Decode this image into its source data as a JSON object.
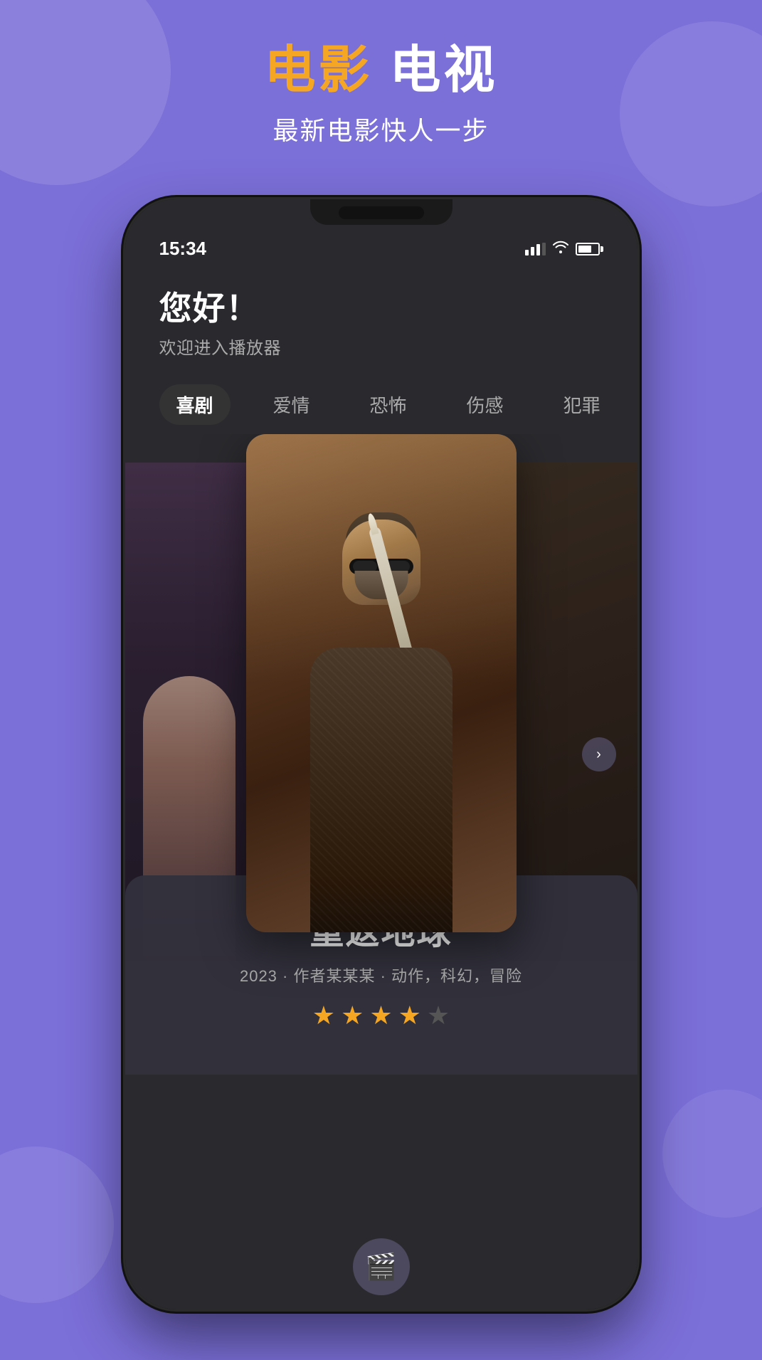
{
  "background": {
    "color": "#7B6FD8"
  },
  "header": {
    "title_movie": "电影",
    "title_tv": "电视",
    "subtitle": "最新电影快人一步"
  },
  "phone": {
    "status_bar": {
      "time": "15:34"
    },
    "greeting": {
      "title": "您好！",
      "subtitle": "欢迎进入播放器"
    },
    "genres": {
      "items": [
        {
          "label": "喜剧",
          "active": true
        },
        {
          "label": "爱情",
          "active": false
        },
        {
          "label": "恐怖",
          "active": false
        },
        {
          "label": "伤感",
          "active": false
        },
        {
          "label": "犯罪",
          "active": false
        }
      ]
    },
    "movie": {
      "title": "重返地球",
      "year": "2023",
      "author": "作者某某某",
      "genres": "动作，科幻，冒险",
      "meta_line": "2023  ·  作者某某某  ·  动作，科幻，冒险",
      "rating": 4,
      "max_rating": 5
    },
    "stars": {
      "filled": [
        "★",
        "★",
        "★",
        "★"
      ],
      "empty": [
        "☆"
      ]
    }
  }
}
